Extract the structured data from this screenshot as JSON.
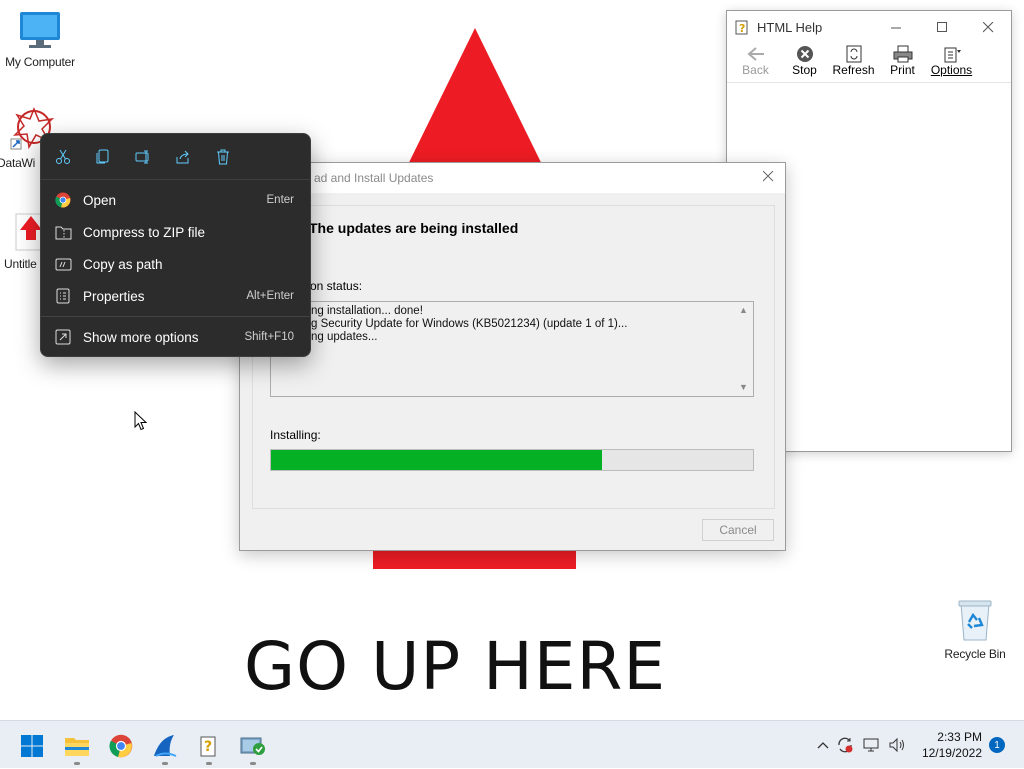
{
  "wallpaper": {
    "text": "GO UP HERE",
    "arrow_color": "#ed1c24"
  },
  "desktop_icons": [
    {
      "label": "My Computer",
      "icon": "monitor-icon"
    },
    {
      "label": "DataWi",
      "icon": "datawin-icon"
    },
    {
      "label": "Untitle",
      "icon": "arrow-document-icon"
    },
    {
      "label": "Recycle Bin",
      "icon": "recycle-bin-icon"
    }
  ],
  "help_window": {
    "title": "HTML Help",
    "toolbar": [
      {
        "label": "Back",
        "icon": "back-arrow-icon",
        "enabled": false
      },
      {
        "label": "Stop",
        "icon": "stop-icon",
        "enabled": true
      },
      {
        "label": "Refresh",
        "icon": "refresh-icon",
        "enabled": true
      },
      {
        "label": "Print",
        "icon": "printer-icon",
        "enabled": true
      },
      {
        "label": "Options",
        "icon": "options-icon",
        "enabled": true
      }
    ]
  },
  "update_dialog": {
    "title": "ad and Install Updates",
    "heading": "The updates are being installed",
    "status_label": "on status:",
    "log_lines": [
      "ng installation... done!",
      "g Security Update for Windows (KB5021234) (update 1 of 1)...",
      "ng updates..."
    ],
    "installing_label": "Installing:",
    "progress_fraction": 0.687,
    "progress_color": "#06b025",
    "cancel_label": "Cancel"
  },
  "context_menu": {
    "quick_actions": [
      "cut-icon",
      "copy-icon",
      "rename-icon",
      "share-icon",
      "delete-icon"
    ],
    "items": [
      {
        "label": "Open",
        "shortcut": "Enter",
        "icon": "chrome-icon"
      },
      {
        "label": "Compress to ZIP file",
        "shortcut": "",
        "icon": "zip-folder-icon"
      },
      {
        "label": "Copy as path",
        "shortcut": "",
        "icon": "copy-path-icon"
      },
      {
        "label": "Properties",
        "shortcut": "Alt+Enter",
        "icon": "properties-icon"
      }
    ],
    "more": {
      "label": "Show more options",
      "shortcut": "Shift+F10",
      "icon": "more-options-icon"
    },
    "accent": "#60cdff"
  },
  "taskbar": {
    "apps": [
      "start-icon",
      "file-explorer-icon",
      "chrome-icon",
      "sharkfin-app-icon",
      "html-help-icon",
      "windows-update-icon"
    ],
    "clock_time": "2:33 PM",
    "clock_date": "12/19/2022",
    "notification_count": "1"
  }
}
